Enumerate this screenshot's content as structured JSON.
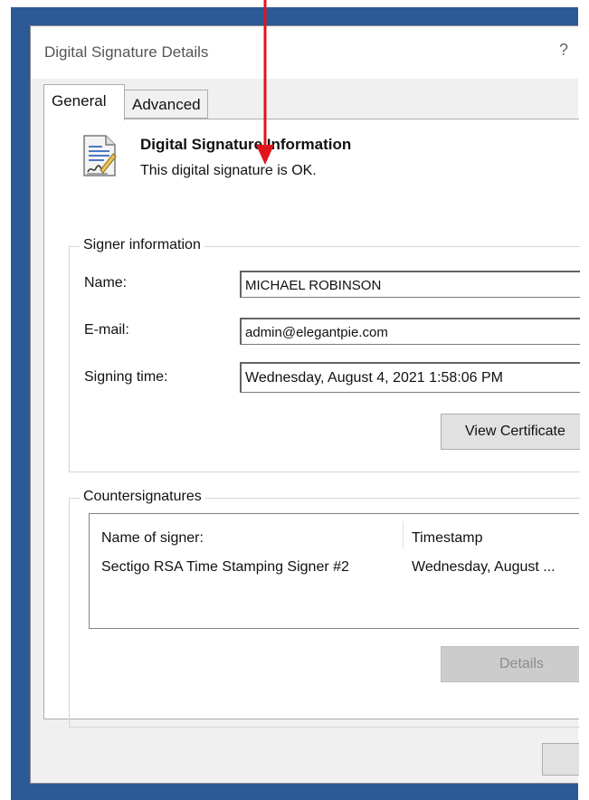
{
  "dialog": {
    "title": "Digital Signature Details",
    "help_label": "?"
  },
  "tabs": [
    {
      "label": "General",
      "selected": true
    },
    {
      "label": "Advanced",
      "selected": false
    }
  ],
  "info": {
    "icon": "signature-document-icon",
    "title": "Digital Signature Information",
    "status": "This digital signature is OK."
  },
  "signer": {
    "group_label": "Signer information",
    "name_label": "Name:",
    "name_value": "MICHAEL ROBINSON",
    "email_label": "E-mail:",
    "email_value": "admin@elegantpie.com",
    "time_label": "Signing time:",
    "time_value": "Wednesday, August 4, 2021 1:58:06 PM",
    "view_cert_label": "View Certificate"
  },
  "countersignatures": {
    "group_label": "Countersignatures",
    "columns": [
      "Name of signer:",
      "Timestamp"
    ],
    "rows": [
      {
        "name": "Sectigo RSA Time Stamping Signer #2",
        "timestamp": "Wednesday, August ..."
      }
    ],
    "details_label": "Details"
  },
  "colors": {
    "backdrop": "#2b5a97",
    "annotation_arrow": "#e0141c"
  }
}
